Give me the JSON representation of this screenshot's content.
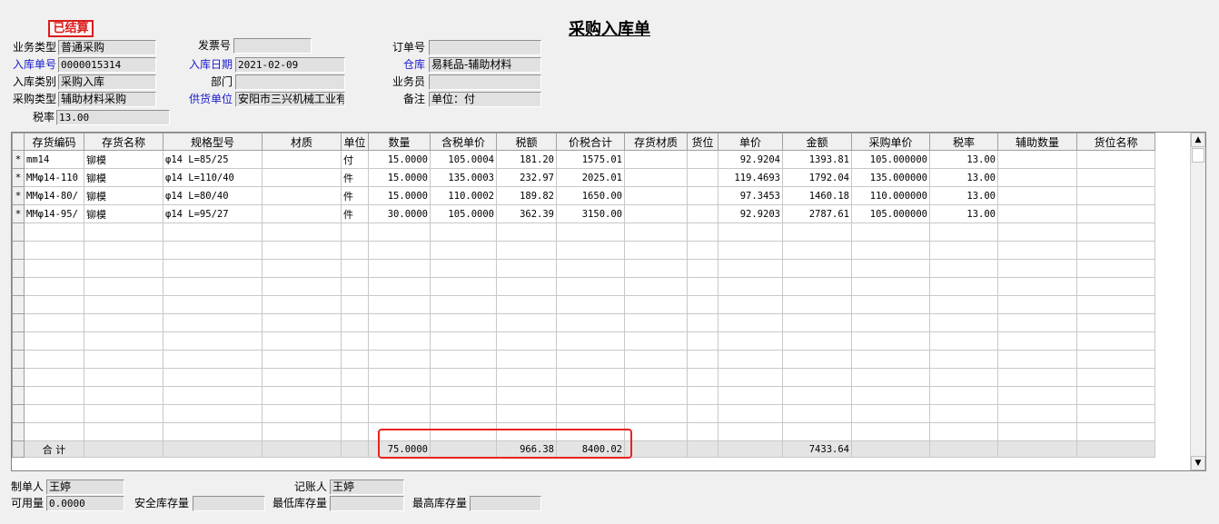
{
  "status_stamp": "已结算",
  "title": "采购入库单",
  "header": {
    "business_type": {
      "label": "业务类型",
      "value": "普通采购"
    },
    "invoice_no": {
      "label": "发票号",
      "value": ""
    },
    "order_no": {
      "label": "订单号",
      "value": ""
    },
    "receipt_no": {
      "label": "入库单号",
      "value": "0000015314"
    },
    "receipt_date": {
      "label": "入库日期",
      "value": "2021-02-09"
    },
    "warehouse": {
      "label": "仓库",
      "value": "易耗品-辅助材料"
    },
    "receipt_category": {
      "label": "入库类别",
      "value": "采购入库"
    },
    "department": {
      "label": "部门",
      "value": ""
    },
    "salesperson": {
      "label": "业务员",
      "value": ""
    },
    "purchase_type": {
      "label": "采购类型",
      "value": "辅助材料采购"
    },
    "supplier": {
      "label": "供货单位",
      "value": "安阳市三兴机械工业有"
    },
    "remark": {
      "label": "备注",
      "value": "单位：付"
    },
    "tax_rate": {
      "label": "税率",
      "value": "13.00"
    }
  },
  "grid": {
    "columns": [
      "",
      "存货编码",
      "存货名称",
      "规格型号",
      "材质",
      "单位",
      "数量",
      "含税单价",
      "税额",
      "价税合计",
      "存货材质",
      "货位",
      "单价",
      "金额",
      "采购单价",
      "税率",
      "辅助数量",
      "货位名称"
    ],
    "rows": [
      [
        "*",
        "mm14",
        "铆模",
        "φ14 L=85/25",
        "",
        "付",
        "15.0000",
        "105.0004",
        "181.20",
        "1575.01",
        "",
        "",
        "92.9204",
        "1393.81",
        "105.000000",
        "13.00",
        "",
        ""
      ],
      [
        "*",
        "MMφ14-110",
        "铆模",
        "φ14 L=110/40",
        "",
        "件",
        "15.0000",
        "135.0003",
        "232.97",
        "2025.01",
        "",
        "",
        "119.4693",
        "1792.04",
        "135.000000",
        "13.00",
        "",
        ""
      ],
      [
        "*",
        "MMφ14-80/",
        "铆模",
        "φ14 L=80/40",
        "",
        "件",
        "15.0000",
        "110.0002",
        "189.82",
        "1650.00",
        "",
        "",
        "97.3453",
        "1460.18",
        "110.000000",
        "13.00",
        "",
        ""
      ],
      [
        "*",
        "MMφ14-95/",
        "铆模",
        "φ14 L=95/27",
        "",
        "件",
        "30.0000",
        "105.0000",
        "362.39",
        "3150.00",
        "",
        "",
        "92.9203",
        "2787.61",
        "105.000000",
        "13.00",
        "",
        ""
      ]
    ],
    "total": {
      "label": "合 计",
      "quantity": "75.0000",
      "tax": "966.38",
      "total_with_tax": "8400.02",
      "amount": "7433.64"
    }
  },
  "footer": {
    "maker": {
      "label": "制单人",
      "value": "王婷"
    },
    "bookkeeper": {
      "label": "记账人",
      "value": "王婷"
    },
    "available_qty": {
      "label": "可用量",
      "value": "0.0000"
    },
    "safety_stock": {
      "label": "安全库存量",
      "value": ""
    },
    "min_stock": {
      "label": "最低库存量",
      "value": ""
    },
    "max_stock": {
      "label": "最高库存量",
      "value": ""
    }
  },
  "colors": {
    "label_blue": "#1a1acc",
    "stamp_red": "#d91c1c",
    "highlight_red": "#e8231f"
  }
}
